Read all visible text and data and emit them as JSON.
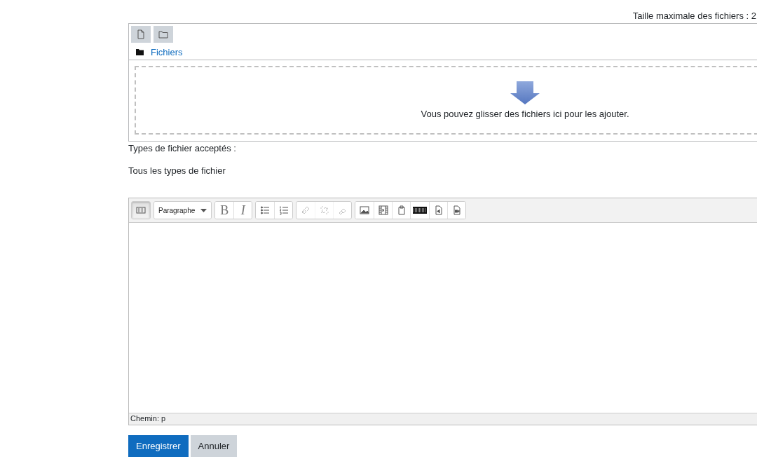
{
  "max_size_label": "Taille maximale des fichiers : 2",
  "file_manager": {
    "toolbar": [
      {
        "kind": "file"
      },
      {
        "kind": "folder"
      }
    ],
    "path": "Fichiers",
    "dropzone_text": "Vous pouvez glisser des fichiers ici pour les ajouter."
  },
  "accepted_types_label": "Types de fichier acceptés :",
  "accepted_types_value": "Tous les types de fichier",
  "editor": {
    "toolbar_groups": [
      [
        {
          "kind": "toggle",
          "pressed": true,
          "disabled": false
        }
      ],
      [
        {
          "kind": "select",
          "label": "Paragraphe"
        }
      ],
      [
        {
          "kind": "bold",
          "label": "B",
          "pressed": false,
          "disabled": false
        },
        {
          "kind": "italic",
          "label": "I",
          "pressed": false,
          "disabled": false
        }
      ],
      [
        {
          "kind": "bullets",
          "pressed": false,
          "disabled": false
        },
        {
          "kind": "numbers",
          "pressed": false,
          "disabled": false
        }
      ],
      [
        {
          "kind": "link",
          "pressed": false,
          "disabled": true
        },
        {
          "kind": "unlink",
          "pressed": false,
          "disabled": true
        },
        {
          "kind": "anchor",
          "pressed": false,
          "disabled": true
        }
      ],
      [
        {
          "kind": "image",
          "pressed": false,
          "disabled": false
        },
        {
          "kind": "media",
          "pressed": false,
          "disabled": false
        },
        {
          "kind": "paste",
          "pressed": false,
          "disabled": false
        },
        {
          "kind": "keyboard",
          "pressed": false,
          "disabled": false
        },
        {
          "kind": "audio",
          "pressed": false,
          "disabled": false
        },
        {
          "kind": "video",
          "pressed": false,
          "disabled": false
        }
      ]
    ],
    "path": "Chemin: p"
  },
  "buttons": [
    {
      "label": "Enregistrer",
      "kind": "primary"
    },
    {
      "label": "Annuler",
      "kind": "secondary"
    }
  ]
}
